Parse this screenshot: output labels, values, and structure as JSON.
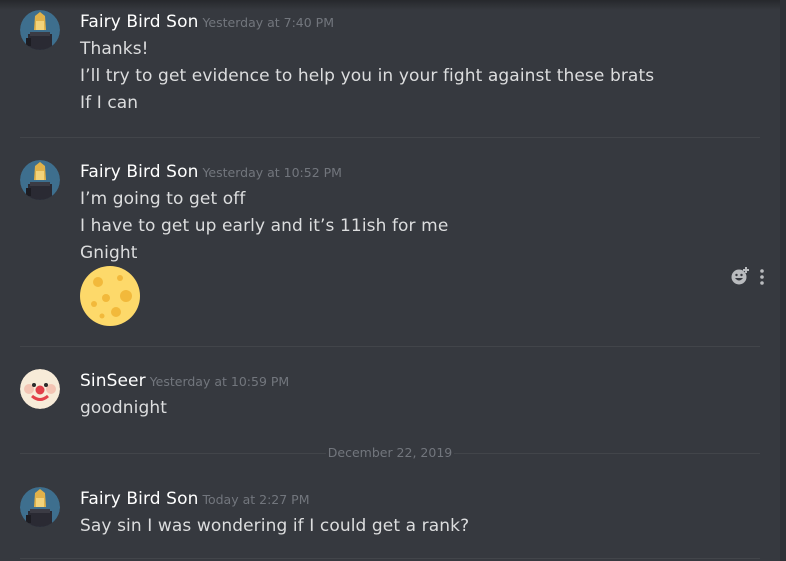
{
  "messages": [
    {
      "username": "Fairy Bird Son",
      "timestamp": "Yesterday at 7:40 PM",
      "lines": [
        "Thanks!",
        "I’ll try to get evidence to help you in your fight against these brats",
        "If I can"
      ]
    },
    {
      "username": "Fairy Bird Son",
      "timestamp": "Yesterday at 10:52 PM",
      "lines": [
        "I’m going to get off",
        "I have to get up early and it’s 11ish for me",
        "Gnight"
      ],
      "attachment": "full-moon-face-emoji"
    },
    {
      "username": "SinSeer",
      "timestamp": "Yesterday at 10:59 PM",
      "lines": [
        "goodnight"
      ]
    },
    {
      "username": "Fairy Bird Son",
      "timestamp": "Today at 2:27 PM",
      "lines": [
        "Say sin I was wondering if I could get a rank?"
      ]
    }
  ],
  "date_divider": "December 22, 2019",
  "actions": {
    "add_reaction_icon": "add-reaction-icon",
    "more_icon": "more-options-icon"
  },
  "colors": {
    "background": "#36393f",
    "username": "#ffffff",
    "text": "#dcddde",
    "timestamp": "#72767d",
    "divider": "#42454a"
  }
}
